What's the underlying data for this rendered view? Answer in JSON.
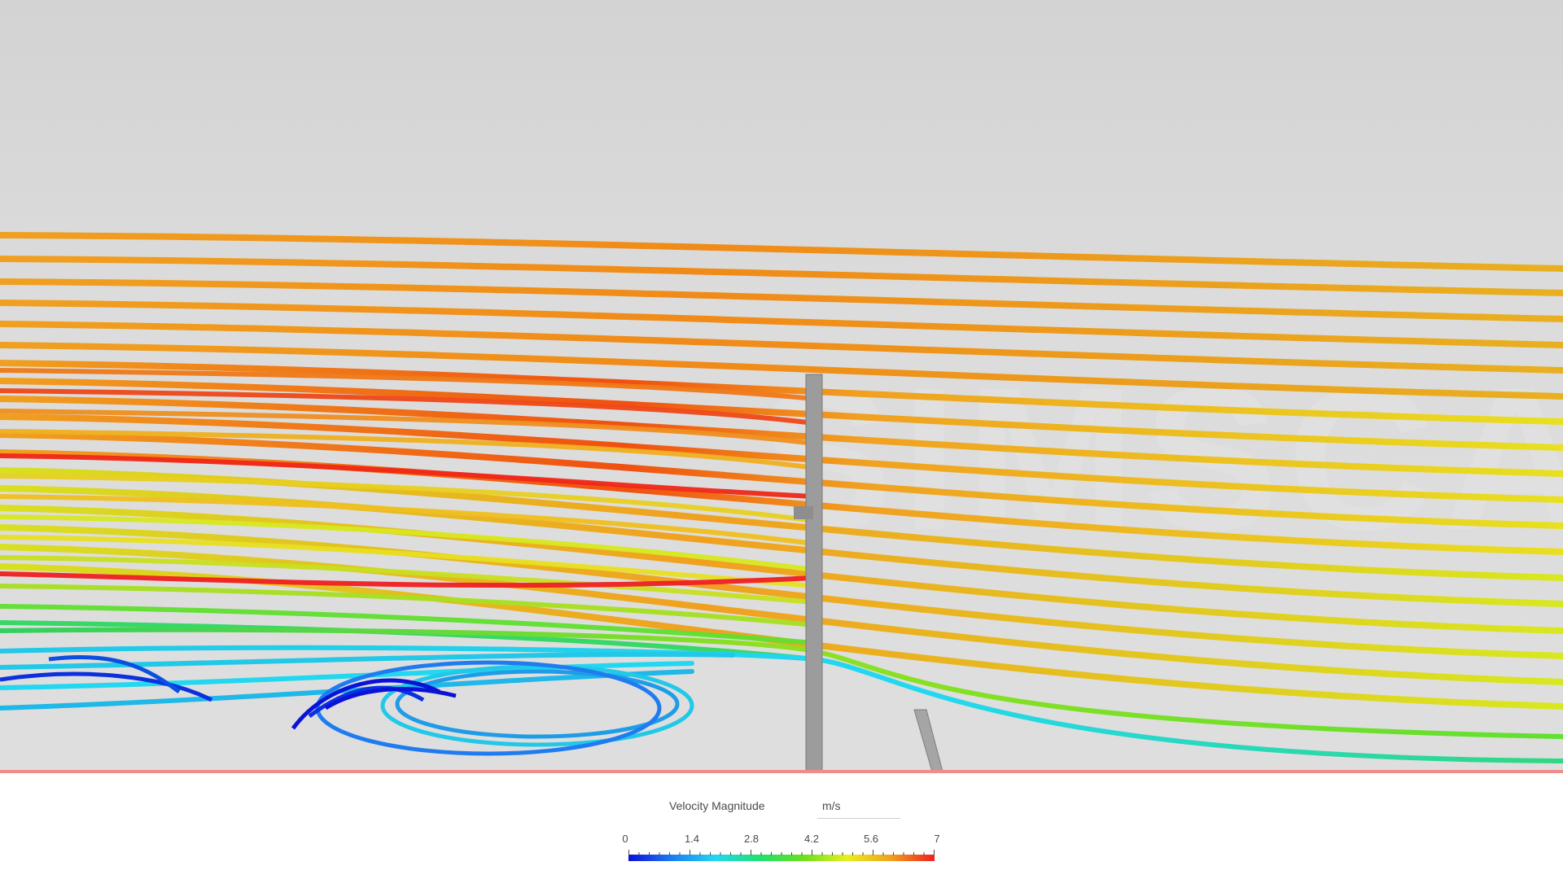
{
  "viewport": {
    "watermark": "SIMSCALE",
    "background_color": "#d8d8d8",
    "content": "streamlines-velocity-field"
  },
  "legend": {
    "title": "Velocity Magnitude",
    "unit": "m/s",
    "min": 0,
    "max": 7,
    "ticks": [
      "0",
      "1.4",
      "2.8",
      "4.2",
      "5.6",
      "7"
    ],
    "colormap": [
      "#0a12d8",
      "#1f7cf0",
      "#22d8f0",
      "#20e070",
      "#6ae020",
      "#e8f020",
      "#f0a020",
      "#f02020"
    ]
  }
}
